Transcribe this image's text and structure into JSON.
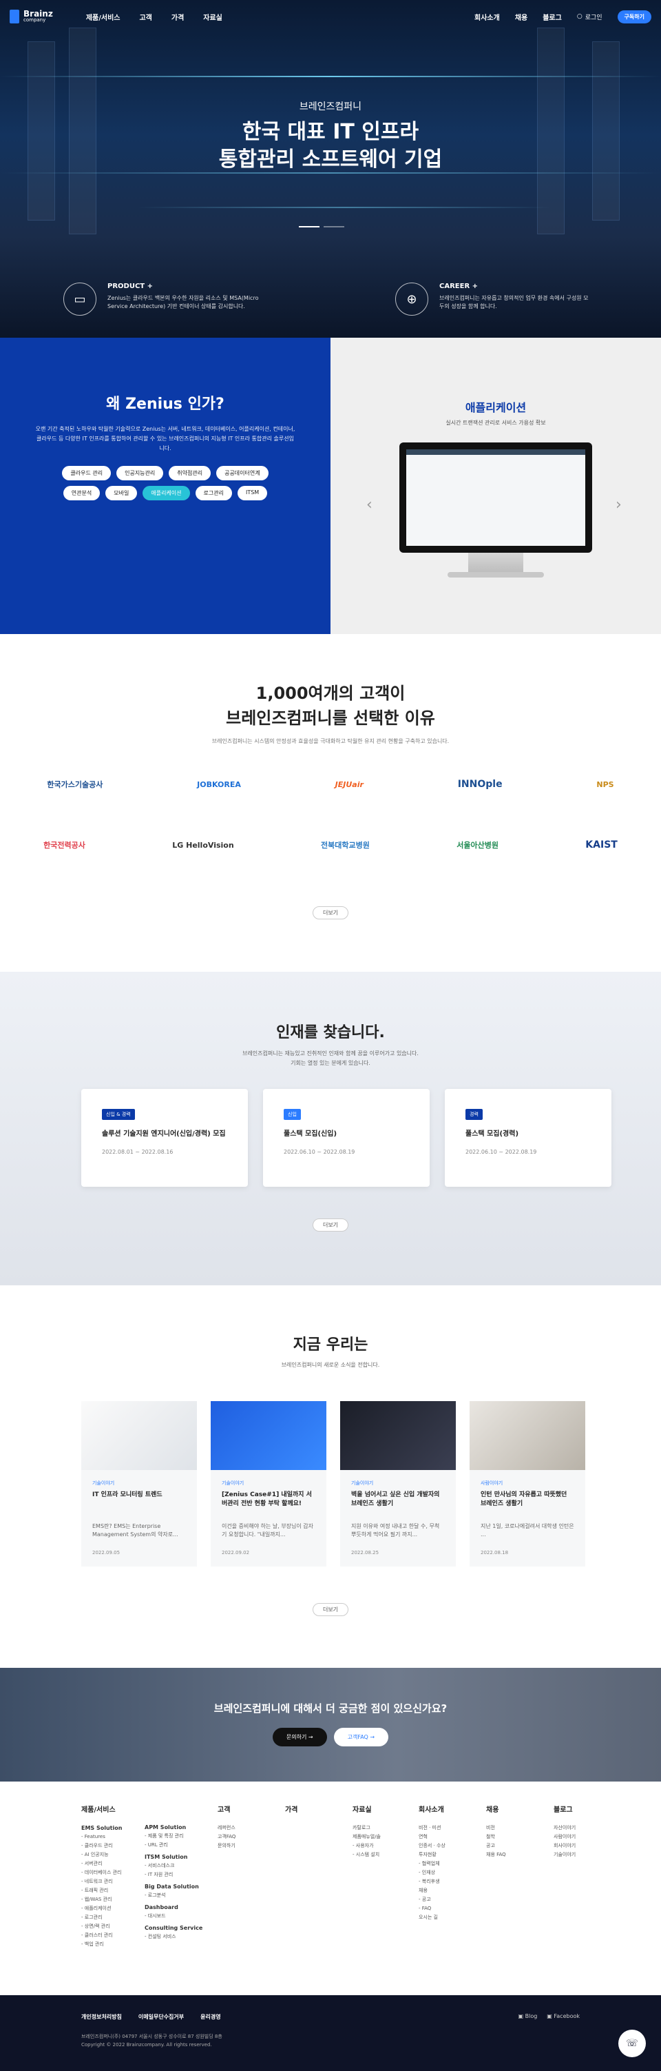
{
  "header": {
    "logo_text": "Brainz",
    "logo_sub": "company",
    "nav": [
      "제품/서비스",
      "고객",
      "가격",
      "자료실"
    ],
    "util": [
      "회사소개",
      "채용",
      "블로그"
    ],
    "login": "로그인",
    "subscribe": "구독하기"
  },
  "hero": {
    "subtitle": "브레인즈컴퍼니",
    "title_line1": "한국 대표 IT 인프라",
    "title_line2": "통합관리 소프트웨어 기업",
    "product": {
      "title": "PRODUCT +",
      "desc": "Zenius는 클라우드 백본의 우수한 자원을 리소스 및 MSA(Micro Service Architecture) 기반 컨테이너 상태를 감시합니다."
    },
    "career": {
      "title": "CAREER +",
      "desc": "브레인즈컴퍼니는 자유롭고 창의적인 업무 환경 속에서 구성원 모두의 성장을 함께 합니다."
    }
  },
  "why": {
    "title": "왜 Zenius 인가?",
    "desc": "오랜 기간 축적된 노하우와 탁월한 기술력으로 Zenius는 서버, 네트워크, 데이터베이스, 어플리케이션, 컨테이너, 클라우드 등 다양한 IT 인프라를 통합하여 관리할 수 있는 브레인즈컴퍼니의 지능형 IT 인프라 통합관리 솔루션입니다.",
    "chips": [
      "클라우드 관리",
      "인공지능관리",
      "취약점관리",
      "공공데이터연계",
      "연관분석",
      "모바일",
      "애플리케이션",
      "로그관리",
      "ITSM"
    ],
    "active_chip": "애플리케이션"
  },
  "app": {
    "title": "애플리케이션",
    "desc": "실시간 트랜잭션 관리로 서비스 가용성 확보"
  },
  "customers": {
    "title_line1": "1,000여개의 고객이",
    "title_line2": "브레인즈컴퍼니를 선택한 이유",
    "desc": "브레인즈컴퍼니는 시스템의 안정성과 효율성을 극대화하고 탁월한 유지 관리 현황을 구축하고 있습니다.",
    "row1": [
      "한국가스기술공사",
      "JOBKOREA",
      "JEJUair",
      "INNOple",
      "NPS"
    ],
    "row2": [
      "한국전력공사",
      "LG HelloVision",
      "전북대학교병원",
      "서울아산병원",
      "KAIST"
    ],
    "more": "더보기"
  },
  "recruit": {
    "title": "인재를 찾습니다.",
    "desc1": "브레인즈컴퍼니는 재능있고 진취적인 인재와 함께 꿈을 이루어가고 있습니다.",
    "desc2": "기회는 열정 있는 분에게 있습니다.",
    "jobs": [
      {
        "tag": "신입 & 경력",
        "title": "솔루션 기술지원 엔지니어(신입/경력) 모집",
        "date": "2022.08.01 ~ 2022.08.16"
      },
      {
        "tag": "신입",
        "title": "풀스택 모집(신입)",
        "date": "2022.06.10 ~ 2022.08.19"
      },
      {
        "tag": "경력",
        "title": "풀스택 모집(경력)",
        "date": "2022.06.10 ~ 2022.08.19"
      }
    ],
    "more": "더보기"
  },
  "now": {
    "title": "지금 우리는",
    "desc": "브레인즈컴퍼니의 새로운 소식을 전합니다.",
    "posts": [
      {
        "cat": "기술이야기",
        "title": "IT 인프라 모니터링 트렌드",
        "summary": "EMS란? EMS는 Enterprise Management System의 약자로...",
        "date": "2022.09.05"
      },
      {
        "cat": "기술이야기",
        "title": "[Zenius Case#1] 내일까지 서버관리 전반 현황 부탁 할께요!",
        "summary": "이건을 증비해야 하는 날, 부장님이 갑자기 요청합니다. \"내일까지...",
        "date": "2022.09.02"
      },
      {
        "cat": "기술이야기",
        "title": "벽을 넘어서고 싶은 신입 개발자의 브레인즈 생활기",
        "summary": "지원 이유와 여정 내내고 한달 수, 무척 뿌듯하게 먹어요 필기 까지...",
        "date": "2022.08.25"
      },
      {
        "cat": "사람이야기",
        "title": "인턴 만사님의 자유롭고 따뜻했던 브레인즈 생활기",
        "summary": "지난 1일, 코로나에걸려서 대학생 인턴은 ...",
        "date": "2022.08.18"
      }
    ],
    "more": "더보기"
  },
  "cta": {
    "title": "브레인즈컴퍼니에 대해서 더 궁금한 점이 있으신가요?",
    "btn1": "문의하기",
    "btn2": "고객FAQ"
  },
  "footer": {
    "cols": [
      {
        "title": "제품/서비스",
        "items": [
          "EMS Solution",
          "- Features",
          "- 클라우드 관리",
          "- AI 인공지능",
          "- 서버관리",
          "- 데이터베이스 관리",
          "- 네트워크 관리",
          "- 트래픽 관리",
          "- 웹/WAS 관리",
          "- 애플리케이션",
          "- 로그관리",
          "- 상면/랙 관리",
          "- 클러스터 관리",
          "- 백업 관리"
        ]
      },
      {
        "title": "",
        "items": [
          "APM Solution",
          "- 제품 및 특징 관리",
          "- URL 관리",
          "ITSM Solution",
          "- 서비스데스크",
          "- IT 자원 관리",
          "Big Data Solution",
          "- 로그분석",
          "Dashboard",
          "- 대시보드",
          "Consulting Service",
          "- 컨설팅 서비스"
        ]
      },
      {
        "title": "고객",
        "items": [
          "레퍼런스",
          "고객FAQ",
          "문의하기"
        ]
      },
      {
        "title": "가격",
        "items": []
      },
      {
        "title": "자료실",
        "items": [
          "카탈로그",
          "제품매뉴얼/솔",
          "- 사용자가",
          "- 시스템 설치"
        ]
      },
      {
        "title": "회사소개",
        "items": [
          "비전 · 미션",
          "연혁",
          "인증서 · 수상",
          "투자현황",
          "- 협력업체",
          "- 인재상",
          "- 복리후생",
          "채용",
          "- 공고",
          "- FAQ",
          "오시는 길"
        ]
      },
      {
        "title": "채용",
        "items": [
          "비전",
          "철학",
          "공고",
          "채용 FAQ"
        ]
      },
      {
        "title": "블로그",
        "items": [
          "자산이야기",
          "사람이야기",
          "회사이야기",
          "기술이야기"
        ]
      }
    ]
  },
  "bottom": {
    "links": [
      "개인정보처리방침",
      "이메일무단수집거부",
      "윤리경영"
    ],
    "address": "브레인즈컴퍼니(주) 04797 서울시 성동구 성수이로 87 성원빌딩 8층",
    "copyright": "Copyright © 2022 Brainzcompany. All rights reserved.",
    "sns": [
      "Blog",
      "Facebook"
    ]
  }
}
